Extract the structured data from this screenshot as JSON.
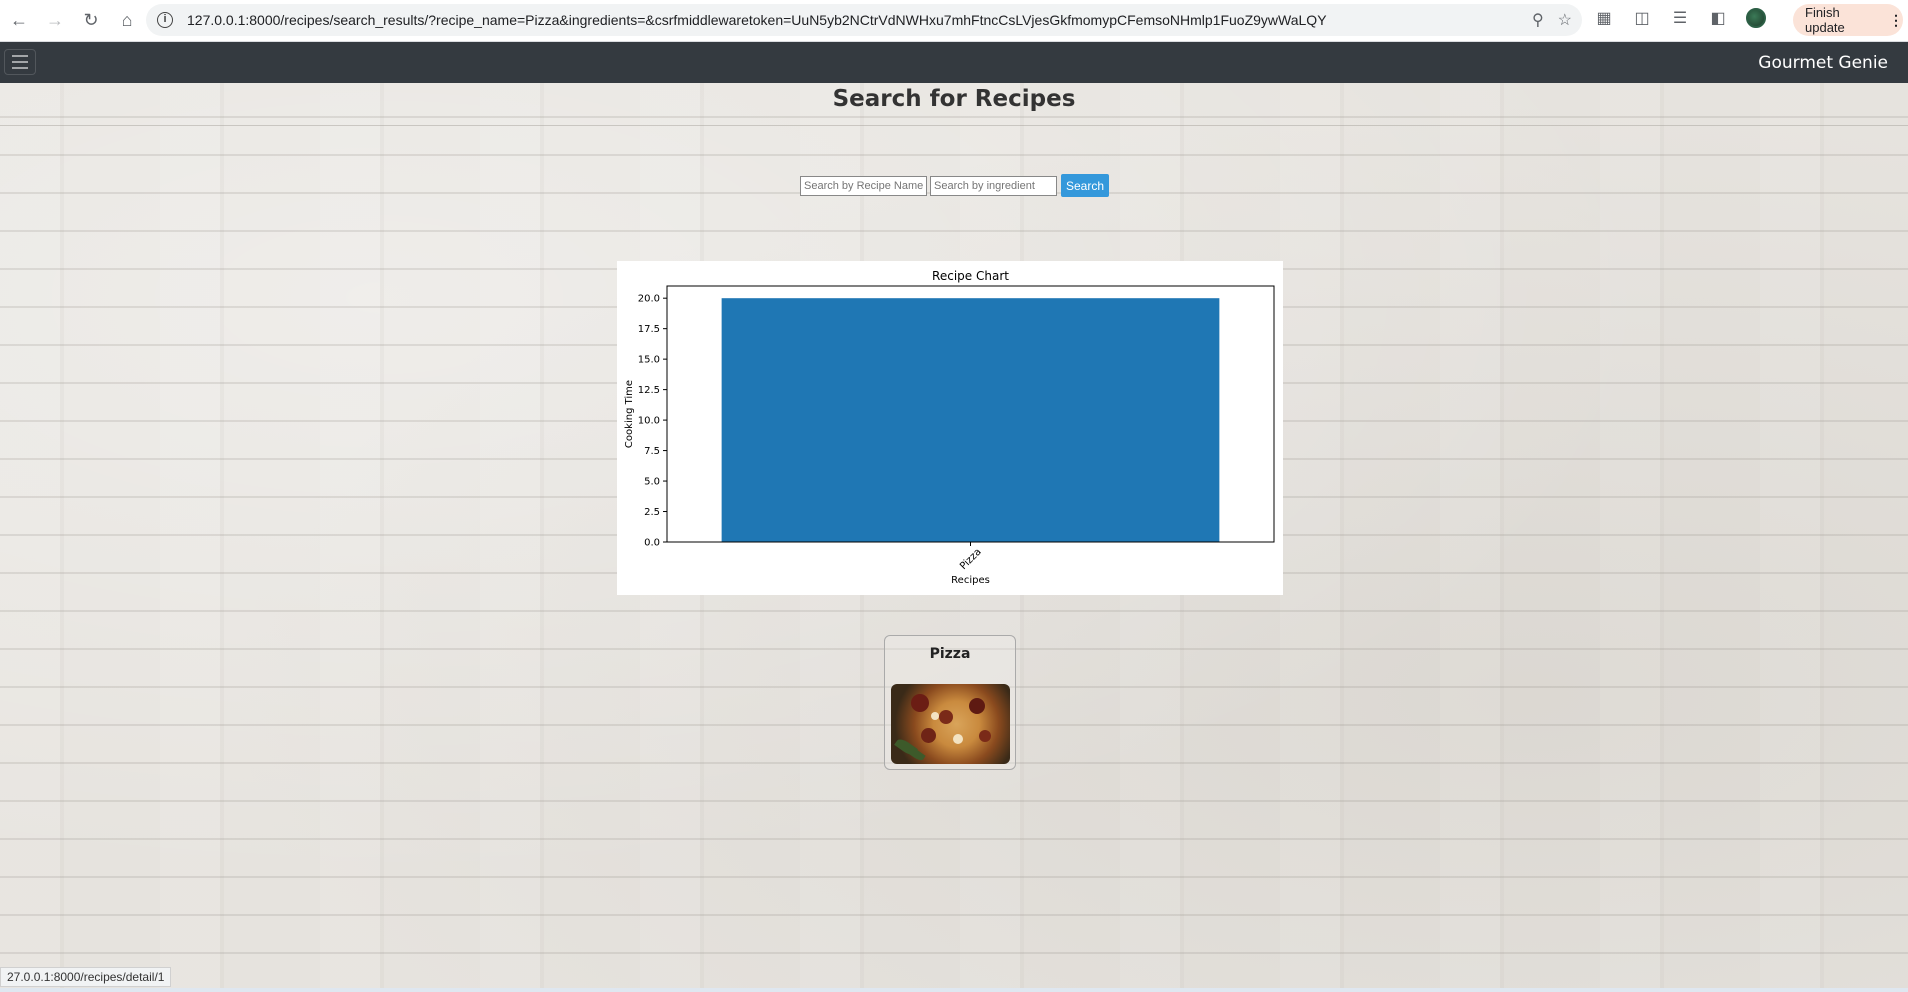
{
  "browser": {
    "url": "127.0.0.1:8000/recipes/search_results/?recipe_name=Pizza&ingredients=&csrfmiddlewaretoken=UuN5yb2NCtrVdNWHxu7mhFtncCsLVjesGkfmomypCFemsoNHmlp1FuoZ9ywWaLQY",
    "finish_update_label": "Finish update",
    "status_link": "27.0.0.1:8000/recipes/detail/1"
  },
  "navbar": {
    "brand": "Gourmet Genie"
  },
  "page": {
    "title": "Search for Recipes"
  },
  "search": {
    "recipe_name_placeholder": "Search by Recipe Name",
    "ingredient_placeholder": "Search by ingredient",
    "button_label": "Search"
  },
  "chart_data": {
    "type": "bar",
    "title": "Recipe Chart",
    "xlabel": "Recipes",
    "ylabel": "Cooking Time",
    "categories": [
      "Pizza"
    ],
    "values": [
      20
    ],
    "ylim": [
      0,
      21
    ],
    "yticks": [
      "0.0",
      "2.5",
      "5.0",
      "7.5",
      "10.0",
      "12.5",
      "15.0",
      "17.5",
      "20.0"
    ],
    "bar_color": "#1f77b4",
    "grid": false
  },
  "results": [
    {
      "title": "Pizza",
      "image": "pizza-photo"
    }
  ]
}
